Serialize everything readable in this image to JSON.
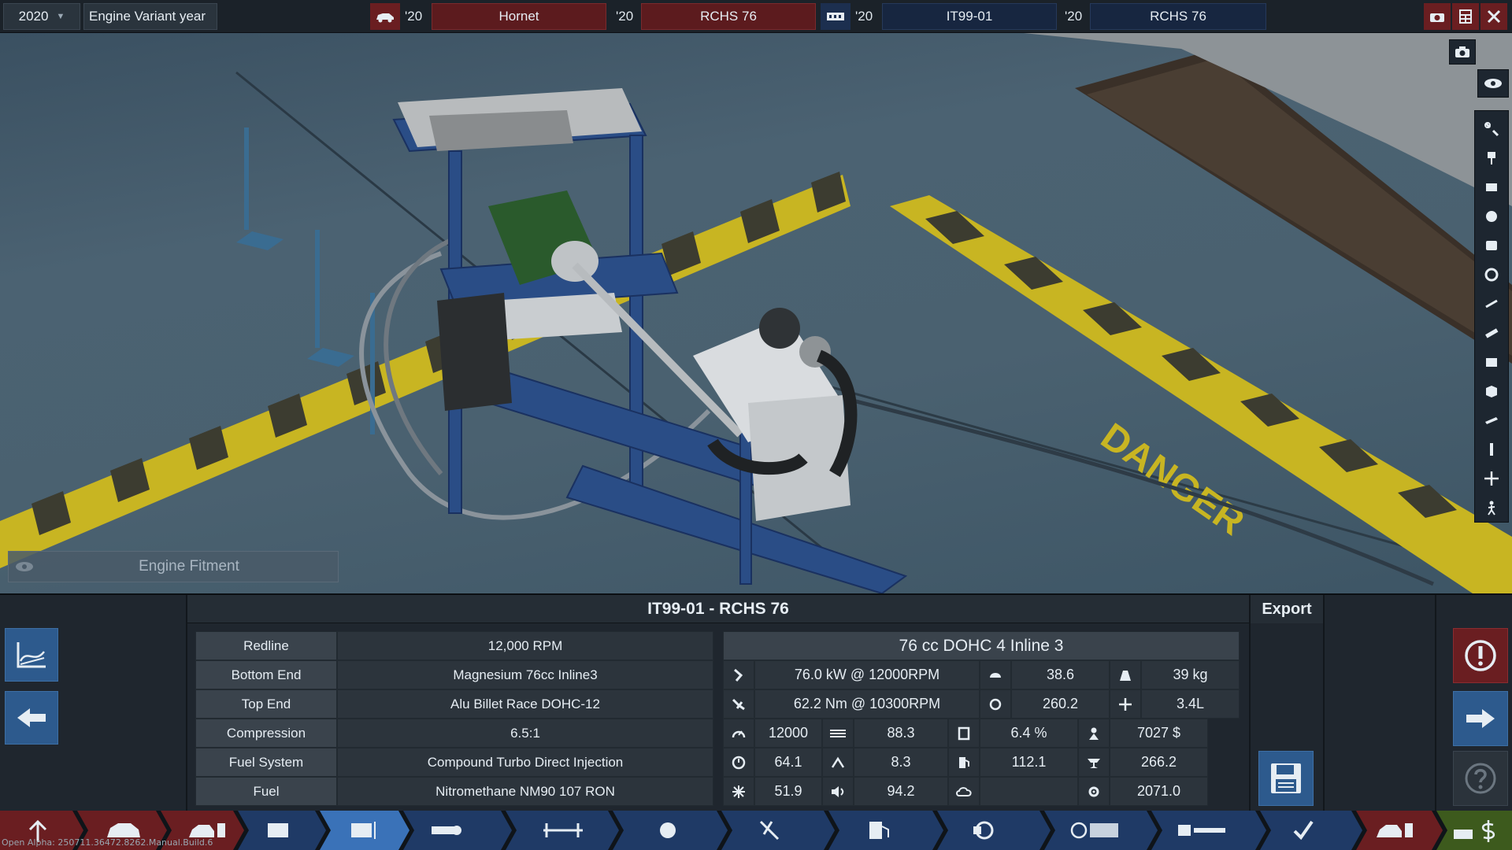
{
  "topbar": {
    "year": "2020",
    "variant_label": "Engine Variant year",
    "car_year": "'20",
    "car_model": "Hornet",
    "car_trim_year": "'20",
    "car_trim": "RCHS 76",
    "engine_year": "'20",
    "engine_family": "IT99-01",
    "engine_variant_year": "'20",
    "engine_variant": "RCHS 76"
  },
  "viewport": {
    "fitment_label": "Engine Fitment",
    "floor_text": "DANGER"
  },
  "panel": {
    "title": "IT99-01 - RCHS 76",
    "export_label": "Export",
    "specs": [
      {
        "key": "Redline",
        "value": "12,000 RPM"
      },
      {
        "key": "Bottom End",
        "value": "Magnesium 76cc Inline3"
      },
      {
        "key": "Top End",
        "value": "Alu Billet Race DOHC-12"
      },
      {
        "key": "Compression",
        "value": "6.5:1"
      },
      {
        "key": "Fuel System",
        "value": "Compound Turbo Direct Injection"
      },
      {
        "key": "Fuel",
        "value": "Nitromethane NM90 107 RON"
      }
    ],
    "stats_title": "76 cc DOHC 4  Inline 3",
    "stats": {
      "power": "76.0 kW @ 12000RPM",
      "torque": "62.2 Nm @ 10300RPM",
      "rpm": "12000",
      "smoothness": "88.3",
      "responsiveness": "64.1",
      "efficiency": "8.3",
      "cooling": "51.9",
      "noise": "94.2",
      "economy": "38.6",
      "emissions": "260.2",
      "fuel_pct": "6.4 %",
      "fuel_other": "112.1",
      "weight": "39 kg",
      "size": "3.4L",
      "cost": "7027 $",
      "prod_units": "266.2",
      "service": "2071.0"
    }
  },
  "build_info": "Open Alpha: 250711.36472.8262.Manual.Build.6",
  "colors": {
    "accent_blue": "#2d5a8d",
    "accent_red": "#6a1e21",
    "panel_bg": "#1f262e"
  }
}
